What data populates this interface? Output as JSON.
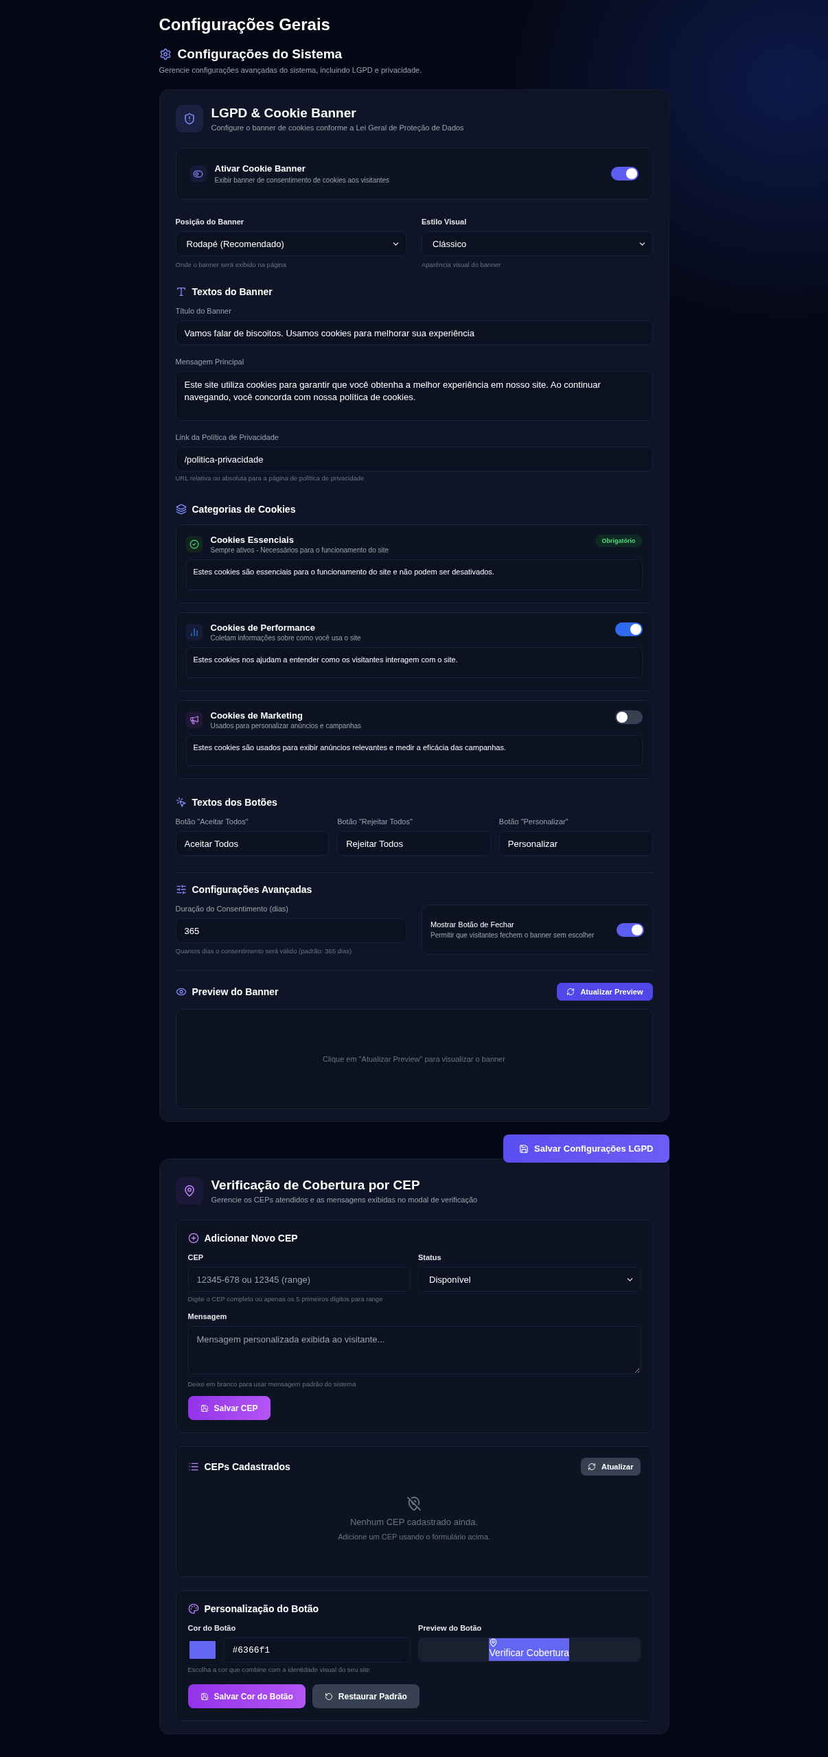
{
  "page_title": "Configurações Gerais",
  "section": {
    "title": "Configurações do Sistema",
    "description": "Gerencie configurações avançadas do sistema, incluindo LGPD e privacidade."
  },
  "lgpd": {
    "title": "LGPD & Cookie Banner",
    "subtitle": "Configure o banner de cookies conforme a Lei Geral de Proteção de Dados",
    "activate": {
      "title": "Ativar Cookie Banner",
      "description": "Exibir banner de consentimento de cookies aos visitantes",
      "on": true
    },
    "selects": [
      {
        "label": "Posição do Banner",
        "value": "Rodapé (Recomendado)",
        "helper": "Onde o banner será exibido na página"
      },
      {
        "label": "Estilo Visual",
        "value": "Clássico",
        "helper": "Aparência visual do banner"
      }
    ],
    "texts_heading": "Textos do Banner",
    "fields": [
      {
        "kind": "input",
        "label": "Título do Banner",
        "value": "Vamos falar de biscoitos. Usamos cookies para melhorar sua experiência"
      },
      {
        "kind": "textarea",
        "label": "Mensagem Principal",
        "value": "Este site utiliza cookies para garantir que você obtenha a melhor experiência em nosso site. Ao continuar navegando, você concorda com nossa política de cookies."
      },
      {
        "kind": "input",
        "label": "Link da Política de Privacidade",
        "value": "/politica-privacidade",
        "helper": "URL relativa ou absoluta para a página de política de privacidade"
      }
    ],
    "categories_heading": "Categorias de Cookies",
    "categories": [
      {
        "kind": "badge",
        "title": "Cookies Essenciais",
        "subtitle": "Sempre ativos - Necessários para o funcionamento do site",
        "badge": "Obrigatório",
        "description": "Estes cookies são essenciais para o funcionamento do site e não podem ser desativados."
      },
      {
        "kind": "toggle",
        "title": "Cookies de Performance",
        "subtitle": "Coletam informações sobre como você usa o site",
        "on": true,
        "description": "Estes cookies nos ajudam a entender como os visitantes interagem com o site."
      },
      {
        "kind": "toggle",
        "title": "Cookies de Marketing",
        "subtitle": "Usados para personalizar anúncios e campanhas",
        "on": false,
        "description": "Estes cookies são usados para exibir anúncios relevantes e medir a eficácia das campanhas."
      }
    ],
    "buttons_heading": "Textos dos Botões",
    "button_fields": [
      {
        "label": "Botão \"Aceitar Todos\"",
        "value": "Aceitar Todos"
      },
      {
        "label": "Botão \"Rejeitar Todos\"",
        "value": "Rejeitar Todos"
      },
      {
        "label": "Botão \"Personalizar\"",
        "value": "Personalizar"
      }
    ],
    "advanced_heading": "Configurações Avançadas",
    "duration": {
      "label": "Duração do Consentimento (dias)",
      "value": "365",
      "helper": "Quantos dias o consentimento será válido (padrão: 365 dias)"
    },
    "close_button": {
      "title": "Mostrar Botão de Fechar",
      "description": "Permitir que visitantes fechem o banner sem escolher",
      "on": true
    },
    "preview": {
      "title": "Preview do Banner",
      "button": "Atualizar Preview",
      "empty": "Clique em \"Atualizar Preview\" para visualizar o banner"
    }
  },
  "save_lgpd": "Salvar Configurações LGPD",
  "cep": {
    "title": "Verificação de Cobertura por CEP",
    "subtitle": "Gerencie os CEPs atendidos e as mensagens exibidas no modal de verificação",
    "add": {
      "heading": "Adicionar Novo CEP",
      "cep": {
        "label": "CEP",
        "placeholder": "12345-678 ou 12345 (range)",
        "helper": "Digite o CEP completo ou apenas os 5 primeiros dígitos para range"
      },
      "status": {
        "label": "Status",
        "value": "Disponível"
      },
      "message": {
        "label": "Mensagem",
        "placeholder": "Mensagem personalizada exibida ao visitante...",
        "helper": "Deixe em branco para usar mensagem padrão do sistema"
      },
      "save": "Salvar CEP"
    },
    "list": {
      "heading": "CEPs Cadastrados",
      "refresh": "Atualizar",
      "empty_title": "Nenhum CEP cadastrado ainda.",
      "empty_hint": "Adicione um CEP usando o formulário acima."
    },
    "custom": {
      "heading": "Personalização do Botão",
      "color_label": "Cor do Botão",
      "color_value": "#6366f1",
      "color_helper": "Escolha a cor que combine com a identidade visual do seu site",
      "preview_label": "Preview do Botão",
      "preview_button": "Verificar Cobertura",
      "save": "Salvar Cor do Botão",
      "restore": "Restaurar Padrão"
    }
  }
}
